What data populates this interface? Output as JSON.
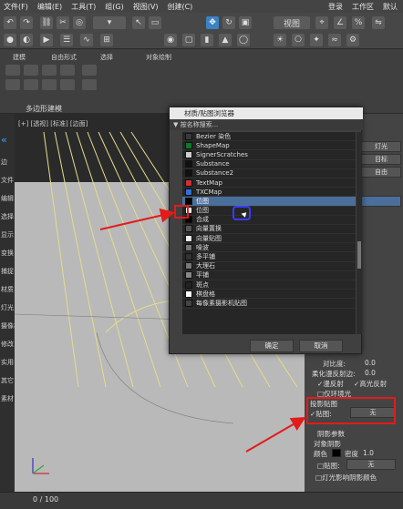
{
  "menu": {
    "items": [
      "文件(F)",
      "编辑(E)",
      "工具(T)",
      "组(G)",
      "视图(V)",
      "创建(C)"
    ],
    "signin": "登录",
    "workspace": "工作区",
    "default": "默认"
  },
  "toolbar": {
    "view_dropdown": "视图"
  },
  "ribbon": {
    "tabs": [
      "建模",
      "自由形式",
      "选择",
      "对象绘制"
    ],
    "panel_label": "多边形建模"
  },
  "leftbar": {
    "items": [
      "层",
      "坐标",
      "边",
      "文件",
      "编辑",
      "选择",
      "显示",
      "变换",
      "捕捉",
      "材质",
      "灯光",
      "摄像机",
      "修改",
      "实用",
      "其它",
      "素材"
    ]
  },
  "viewport": {
    "label": "[+] [透视] [标准] [边面]"
  },
  "dialog": {
    "title": "材质/贴图浏览器",
    "search_placeholder": "按名称搜索...",
    "items": [
      "Bezier 染色",
      "ShapeMap",
      "SignerScratches",
      "Substance",
      "Substance2",
      "TextMap",
      "TXCMap",
      "位图",
      "位图",
      "合成",
      "向量置换",
      "向量贴图",
      "噪波",
      "多平铺",
      "大理石",
      "平铺",
      "斑点",
      "棋盘格",
      "每像素摄影机贴图"
    ],
    "selected_index": 7,
    "ok": "确定",
    "cancel": "取消"
  },
  "rightpanel": {
    "list_item1": "灯光",
    "list_item2": "目标",
    "list_item3": "自由",
    "number_label": "对比度:",
    "number1": "0.0",
    "softness_label": "柔化漫反射边:",
    "number2": "0.0",
    "diffuse": "漫反射",
    "specular": "高光反射",
    "ambient": "仅环境光",
    "projector_title": "投影贴图",
    "map_label": "贴图:",
    "map_value": "无",
    "shadow_title": "阴影参数",
    "object_shadows": "对象阴影",
    "color_label": "颜色",
    "density_label": "密度",
    "density_value": "1.0",
    "shadow_map_label": "贴图:",
    "shadow_map_value": "无",
    "light_affects": "灯光影响阴影颜色",
    "accent": "#ffffff"
  },
  "timeline": {
    "frame": "0 / 100"
  },
  "colors": {
    "highlight": "#e21b1b",
    "selection": "#4a6f9a",
    "accent": "#3b82c4"
  }
}
